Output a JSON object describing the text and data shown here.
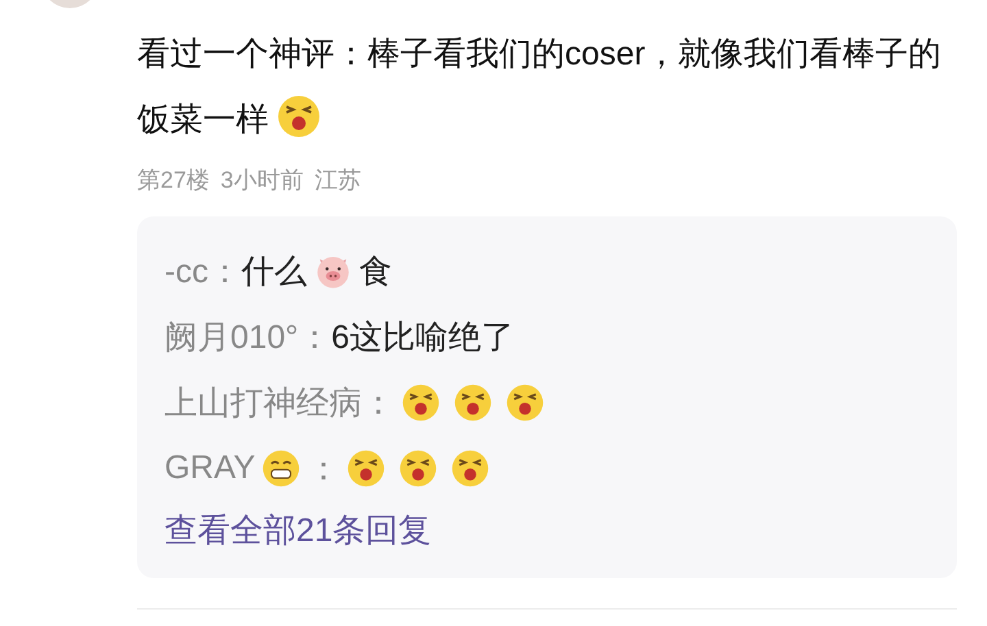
{
  "comment": {
    "content": [
      {
        "kind": "text",
        "text": "看过一个神评：棒子看我们的coser，就像我们看棒子的饭菜一样"
      },
      {
        "kind": "laugh"
      }
    ],
    "meta": [
      "第27楼",
      "3小时前",
      "江苏"
    ]
  },
  "replies": [
    {
      "author": [
        {
          "kind": "text",
          "text": "-cc："
        }
      ],
      "content": [
        {
          "kind": "text",
          "text": "什么"
        },
        {
          "kind": "pig"
        },
        {
          "kind": "text",
          "text": "食"
        }
      ]
    },
    {
      "author": [
        {
          "kind": "text",
          "text": "阙月010°："
        }
      ],
      "content": [
        {
          "kind": "text",
          "text": "6这比喻绝了"
        }
      ]
    },
    {
      "author": [
        {
          "kind": "text",
          "text": "上山打神经病："
        }
      ],
      "content": [
        {
          "kind": "laugh"
        },
        {
          "kind": "laugh"
        },
        {
          "kind": "laugh"
        }
      ]
    },
    {
      "author": [
        {
          "kind": "text",
          "text": "GRAY"
        },
        {
          "kind": "grin"
        },
        {
          "kind": "text",
          "text": "："
        }
      ],
      "content": [
        {
          "kind": "laugh"
        },
        {
          "kind": "laugh"
        },
        {
          "kind": "laugh"
        }
      ]
    }
  ],
  "more_link": "查看全部21条回复"
}
